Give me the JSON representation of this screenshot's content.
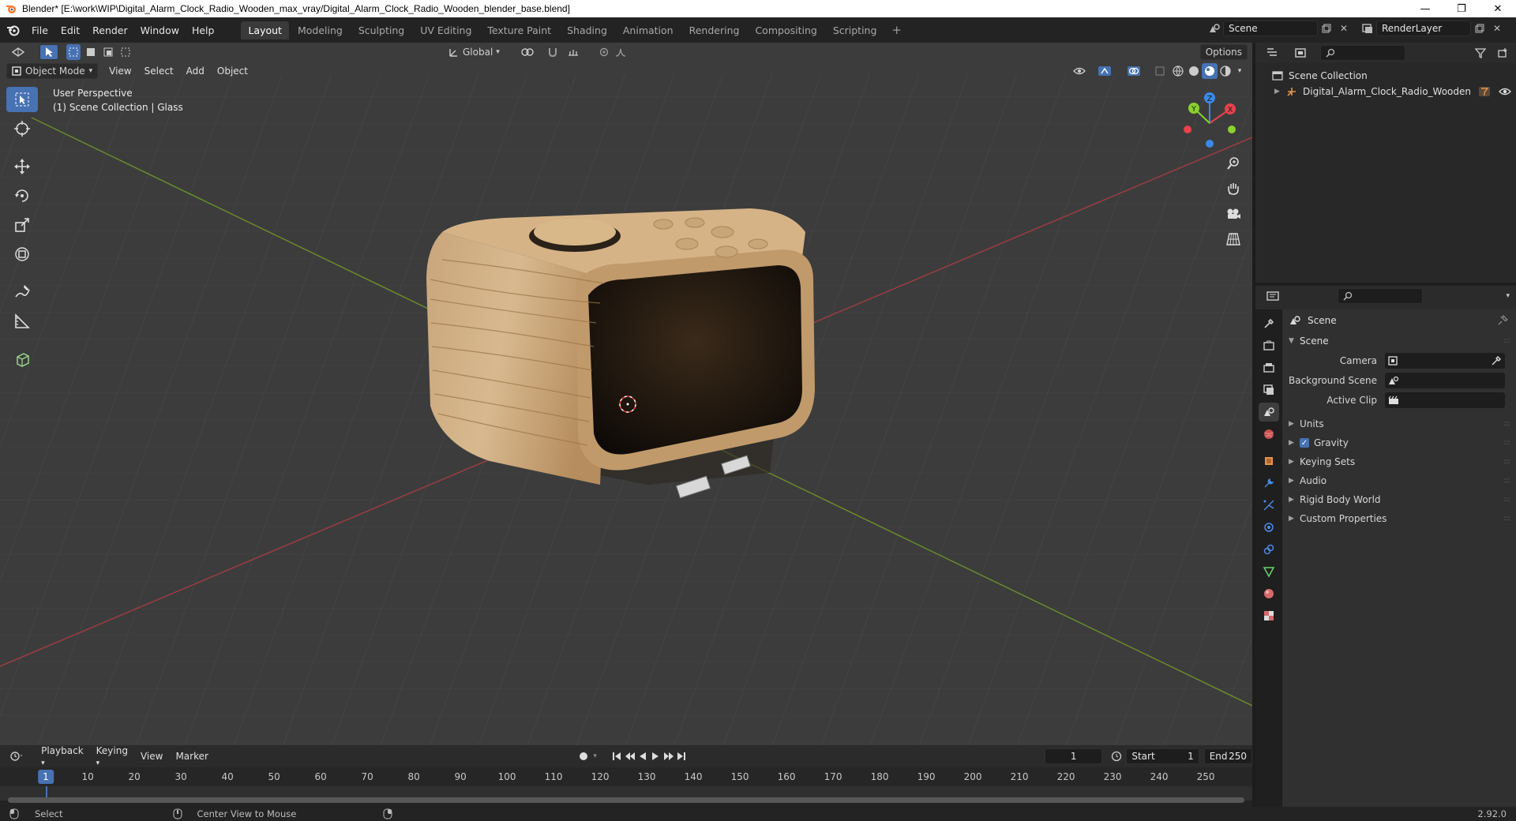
{
  "window": {
    "title": "Blender* [E:\\work\\WIP\\Digital_Alarm_Clock_Radio_Wooden_max_vray/Digital_Alarm_Clock_Radio_Wooden_blender_base.blend]",
    "minimize": "—",
    "maximize": "❐",
    "close": "✕"
  },
  "menu": {
    "items": [
      "File",
      "Edit",
      "Render",
      "Window",
      "Help"
    ]
  },
  "workspaces": {
    "tabs": [
      "Layout",
      "Modeling",
      "Sculpting",
      "UV Editing",
      "Texture Paint",
      "Shading",
      "Animation",
      "Rendering",
      "Compositing",
      "Scripting"
    ],
    "active": "Layout",
    "add": "+"
  },
  "scene": {
    "scene_name": "Scene",
    "view_layer": "RenderLayer"
  },
  "viewport": {
    "transform_orientation": "Global",
    "options": "Options",
    "mode": "Object Mode",
    "menus": [
      "View",
      "Select",
      "Add",
      "Object"
    ],
    "overlay_line1": "User Perspective",
    "overlay_line2": "(1) Scene Collection | Glass",
    "gizmo": {
      "x": "X",
      "y": "Y",
      "z": "Z"
    }
  },
  "timeline": {
    "menus": [
      "Playback",
      "Keying",
      "View",
      "Marker"
    ],
    "current_frame": "1",
    "start_label": "Start",
    "start_value": "1",
    "end_label": "End",
    "end_value": "250",
    "ticks": [
      "1",
      "10",
      "20",
      "30",
      "40",
      "50",
      "60",
      "70",
      "80",
      "90",
      "100",
      "110",
      "120",
      "130",
      "140",
      "150",
      "160",
      "170",
      "180",
      "190",
      "200",
      "210",
      "220",
      "230",
      "240",
      "250"
    ]
  },
  "statusbar": {
    "left": "Select",
    "middle": "Center View to Mouse",
    "version": "2.92.0"
  },
  "outliner": {
    "root": "Scene Collection",
    "object": "Digital_Alarm_Clock_Radio_Wooden"
  },
  "properties": {
    "context": "Scene",
    "panel": "Scene",
    "rows": [
      {
        "label": "Camera"
      },
      {
        "label": "Background Scene"
      },
      {
        "label": "Active Clip"
      }
    ],
    "subpanels": [
      "Units",
      "Gravity",
      "Keying Sets",
      "Audio",
      "Rigid Body World",
      "Custom Properties"
    ]
  },
  "colors": {
    "accent": "#4772b3",
    "x_axis": "#e8424d",
    "y_axis": "#8bd12f",
    "z_axis": "#3a8ae8",
    "grid_x_line": "#9b3c43",
    "grid_y_line": "#6a8a2c"
  }
}
